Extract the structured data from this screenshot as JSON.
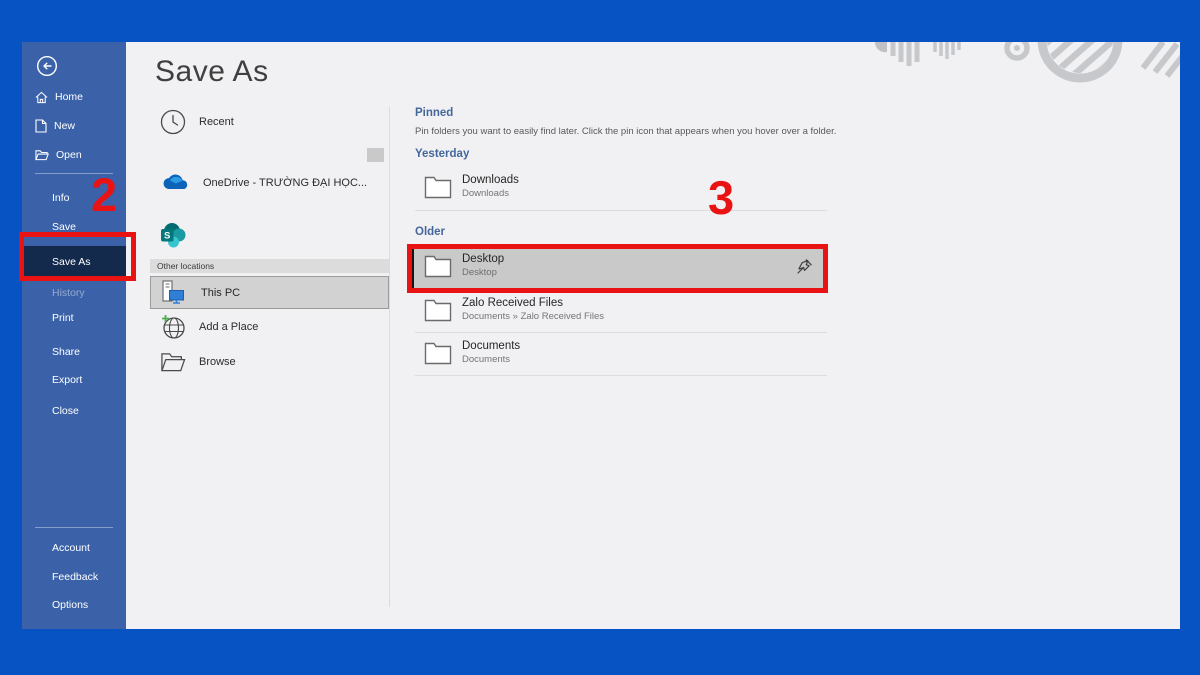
{
  "annotations": {
    "step2": "2",
    "step3": "3",
    "red": "#E91313"
  },
  "sidebar": {
    "top_items": [
      {
        "label": "Home"
      },
      {
        "label": "New"
      },
      {
        "label": "Open"
      }
    ],
    "menu_items": [
      {
        "label": "Info"
      },
      {
        "label": "Save"
      },
      {
        "label": "Save As",
        "selected": true
      },
      {
        "label": "History",
        "disabled": true
      },
      {
        "label": "Print"
      },
      {
        "label": "Share"
      },
      {
        "label": "Export"
      },
      {
        "label": "Close"
      }
    ],
    "bottom_items": [
      {
        "label": "Account"
      },
      {
        "label": "Feedback"
      },
      {
        "label": "Options"
      }
    ]
  },
  "main": {
    "title": "Save As"
  },
  "places": {
    "recent": "Recent",
    "onedrive": "OneDrive - TRƯỜNG ĐẠI HỌC...",
    "other_locations_heading": "Other locations",
    "this_pc": "This PC",
    "add_place": "Add a Place",
    "browse": "Browse"
  },
  "folders": {
    "pinned_heading": "Pinned",
    "pinned_description": "Pin folders you want to easily find later. Click the pin icon that appears when you hover over a folder.",
    "yesterday_heading": "Yesterday",
    "older_heading": "Older",
    "items": [
      {
        "name": "Downloads",
        "path": "Downloads"
      },
      {
        "name": "Desktop",
        "path": "Desktop",
        "selected": true,
        "pinned": true
      },
      {
        "name": "Zalo Received Files",
        "path": "Documents » Zalo Received Files"
      },
      {
        "name": "Documents",
        "path": "Documents"
      }
    ]
  },
  "colors": {
    "frame": "#0753C4",
    "sidebar": "#3B62A9",
    "selected_navy": "#132A4D",
    "heading_blue": "#44679B",
    "content_bg": "#F1F1F3"
  }
}
